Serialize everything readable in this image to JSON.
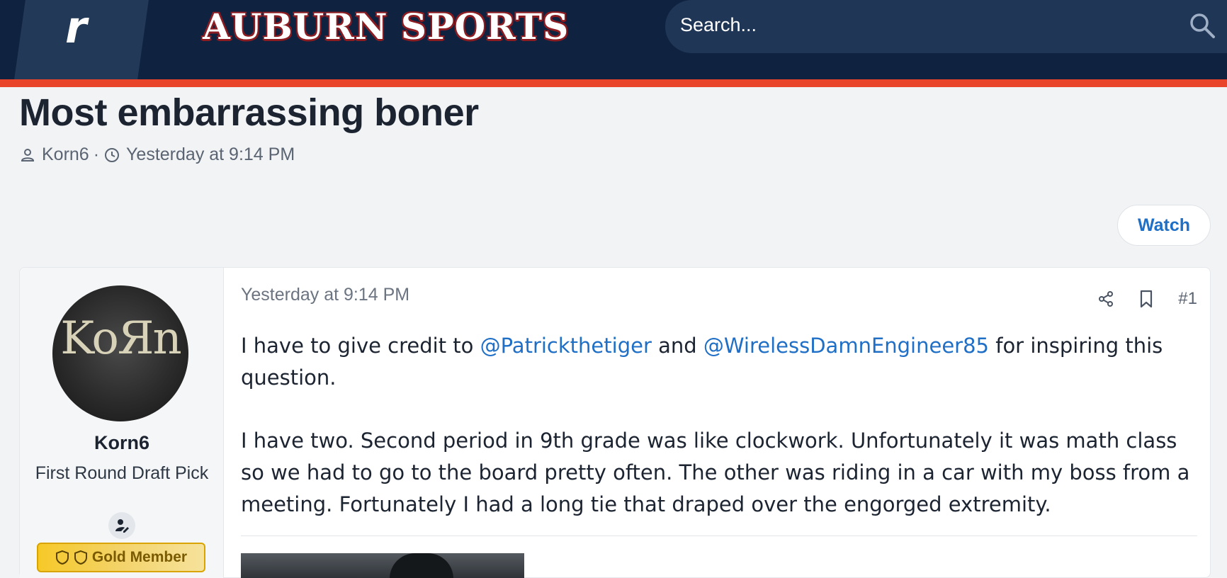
{
  "header": {
    "logo_letter": "r",
    "brand": "AUBURN SPORTS",
    "search_placeholder": "Search..."
  },
  "colors": {
    "header_bg": "#0f2340",
    "accent_stripe": "#e8452a",
    "link": "#1f6fc6",
    "gold": "#f6c928"
  },
  "thread": {
    "title": "Most embarrassing boner",
    "author": "Korn6",
    "separator": "·",
    "time": "Yesterday at 9:14 PM",
    "watch_label": "Watch"
  },
  "post": {
    "user": {
      "avatar_text": "KoЯn",
      "name": "Korn6",
      "title": "First Round Draft Pick",
      "badge_label": "Gold Member"
    },
    "date": "Yesterday at 9:14 PM",
    "number": "#1",
    "text": {
      "p1_a": "I have to give credit to ",
      "mention1": "@Patrickthetiger",
      "p1_b": " and ",
      "mention2": "@WirelessDamnEngineer85",
      "p1_c": " for inspiring this question.",
      "p2": "I have two. Second period in 9th grade was like clockwork. Unfortunately it was math class so we had to go to the board pretty often. The other was riding in a car with my boss from a meeting. Fortunately I had a long tie that draped over the engorged extremity."
    }
  },
  "icons": [
    "search-icon",
    "user-icon",
    "clock-icon",
    "share-icon",
    "bookmark-icon",
    "user-edit-icon",
    "shield-icon"
  ]
}
